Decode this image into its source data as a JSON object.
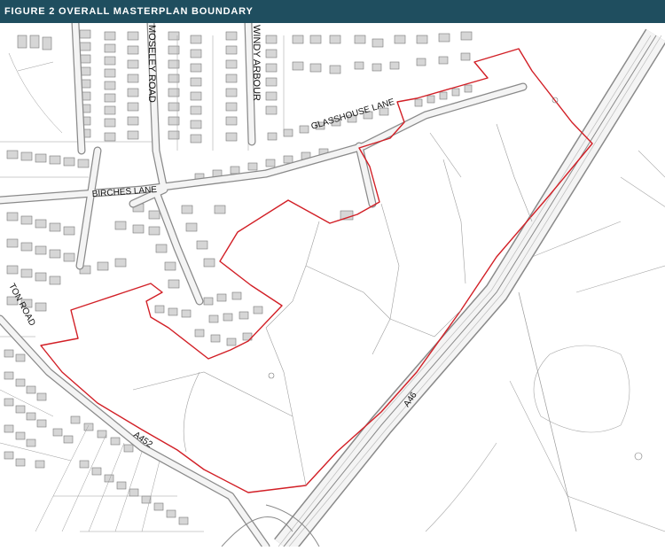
{
  "header": {
    "title": "FIGURE 2  OVERALL MASTERPLAN BOUNDARY"
  },
  "map": {
    "road_labels": {
      "moseley_road": "MOSELEY ROAD",
      "windy_arbour": "WINDY ARBOUR",
      "glasshouse_lane": "GLASSHOUSE LANE",
      "birches_lane": "BIRCHES LANE",
      "ton_road": "TON ROAD",
      "a46": "A46",
      "a452": "A452"
    },
    "colors": {
      "boundary": "#d21f26",
      "road_fill": "#f4f4f4",
      "road_casing": "#8a8a8a",
      "building": "#d0d0d0",
      "building_edge": "#777777",
      "header_bg": "#1f4e5f"
    }
  }
}
